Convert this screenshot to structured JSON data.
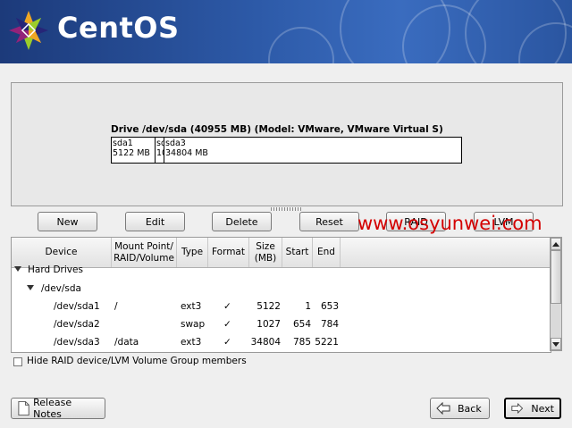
{
  "header": {
    "brand": "CentOS"
  },
  "drive": {
    "title": "Drive /dev/sda (40955 MB) (Model: VMware, VMware Virtual S)",
    "segments": [
      {
        "line1": "sda1",
        "line2": "5122 MB",
        "size_mb": 5122
      },
      {
        "line1": "sd",
        "line2": "10",
        "size_mb": 1027
      },
      {
        "line1": "sda3",
        "line2": "34804 MB",
        "size_mb": 34804
      }
    ]
  },
  "toolbar": {
    "new": "New",
    "edit": "Edit",
    "delete": "Delete",
    "reset": "Reset",
    "raid": "RAID",
    "lvm": "LVM"
  },
  "watermark": "www.osyunwei.com",
  "table": {
    "headers": {
      "device": "Device",
      "mount1": "Mount Point/",
      "mount2": "RAID/Volume",
      "type": "Type",
      "format": "Format",
      "size1": "Size",
      "size2": "(MB)",
      "start": "Start",
      "end": "End"
    },
    "group_label": "Hard Drives",
    "disk_label": "/dev/sda",
    "format_mark": "✓",
    "rows": [
      {
        "device": "/dev/sda1",
        "mount": "/",
        "type": "ext3",
        "format": "✓",
        "size": "5122",
        "start": "1",
        "end": "653"
      },
      {
        "device": "/dev/sda2",
        "mount": "",
        "type": "swap",
        "format": "✓",
        "size": "1027",
        "start": "654",
        "end": "784"
      },
      {
        "device": "/dev/sda3",
        "mount": "/data",
        "type": "ext3",
        "format": "✓",
        "size": "34804",
        "start": "785",
        "end": "5221"
      }
    ]
  },
  "options": {
    "hide_raid_label": "Hide RAID device/LVM Volume Group members",
    "hide_raid_checked": false
  },
  "footer": {
    "release_notes": "Release Notes",
    "back": "Back",
    "next": "Next"
  }
}
